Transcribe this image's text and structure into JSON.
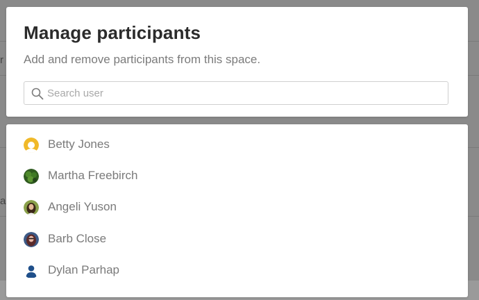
{
  "background": {
    "chars": [
      "r",
      "a"
    ]
  },
  "dialog": {
    "title": "Manage participants",
    "subtitle": "Add and remove participants from this space.",
    "search": {
      "placeholder": "Search user",
      "value": ""
    }
  },
  "users": [
    {
      "name": "Betty Jones",
      "avatar_icon": "default-avatar-icon"
    },
    {
      "name": "Martha Freebirch",
      "avatar_icon": "photo-avatar"
    },
    {
      "name": "Angeli Yuson",
      "avatar_icon": "photo-avatar"
    },
    {
      "name": "Barb Close",
      "avatar_icon": "photo-avatar"
    },
    {
      "name": "Dylan Parhap",
      "avatar_icon": "default-person-icon"
    }
  ],
  "colors": {
    "accent_avatar": "#f0b929",
    "person_icon": "#1f4f8a",
    "overlay": "#8a8a8a"
  }
}
